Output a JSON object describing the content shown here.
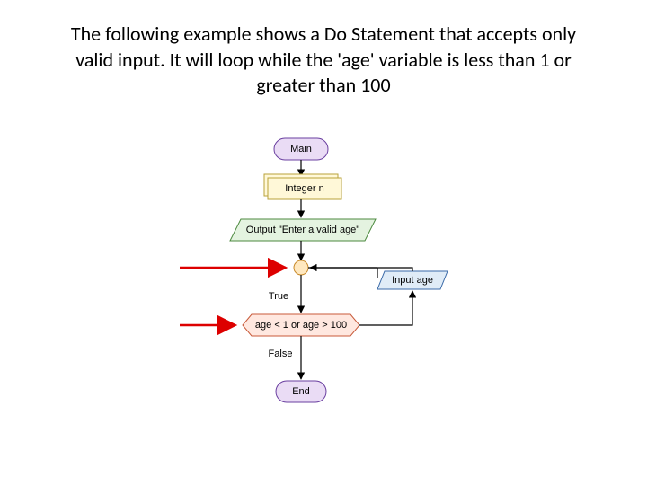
{
  "title": "The following example shows a Do Statement that accepts only valid input. It will loop while the 'age' variable is less than 1 or greater than 100",
  "nodes": {
    "main": "Main",
    "decl": "Integer n",
    "output": "Output \"Enter a valid age\"",
    "input": "Input age",
    "cond": "age < 1 or age > 100",
    "end": "End"
  },
  "labels": {
    "true": "True",
    "false": "False"
  }
}
